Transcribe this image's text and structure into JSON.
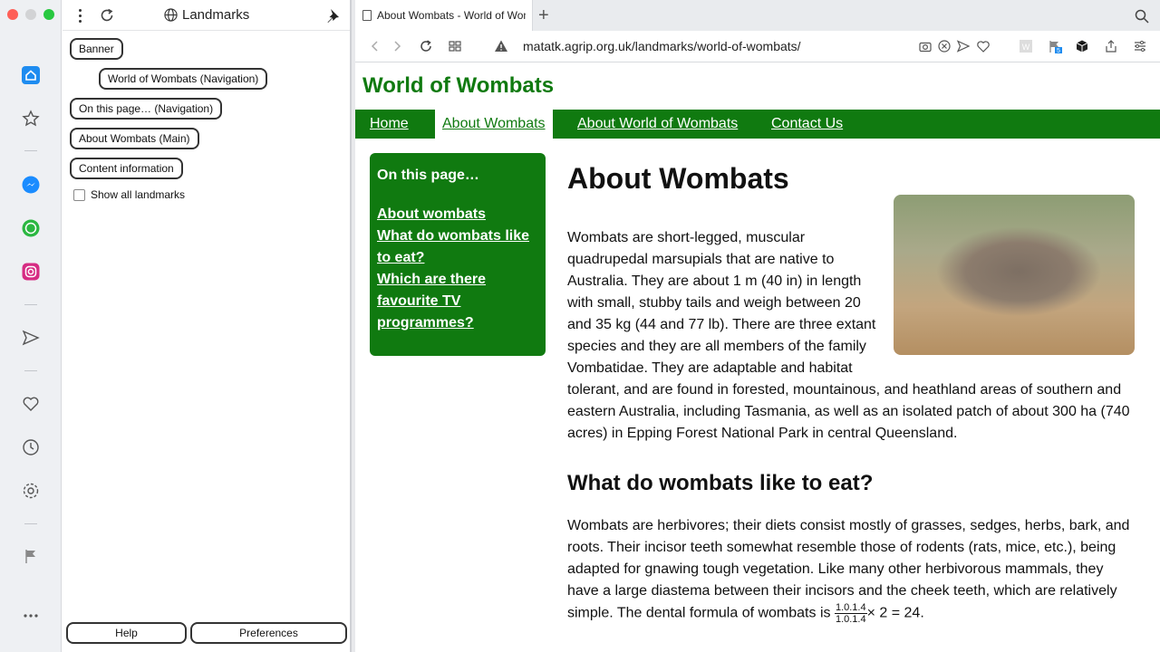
{
  "panel": {
    "title": "Landmarks",
    "landmarks": [
      "Banner",
      "World of Wombats (Navigation)",
      "On this page… (Navigation)",
      "About Wombats (Main)",
      "Content information"
    ],
    "show_all_label": "Show all landmarks",
    "help_label": "Help",
    "preferences_label": "Preferences"
  },
  "browser": {
    "tab_title": "About Wombats - World of Wombats",
    "new_tab": "+",
    "url": "matatk.agrip.org.uk/landmarks/world-of-wombats/"
  },
  "site": {
    "title": "World of Wombats",
    "nav": [
      "Home",
      "About Wombats",
      "About World of Wombats",
      "Contact Us"
    ],
    "toc": {
      "heading": "On this page…",
      "links": [
        "About wombats",
        "What do wombats like to eat?",
        "Which are there favourite TV programmes?"
      ]
    },
    "main": {
      "h1": "About Wombats",
      "p1": "Wombats are short-legged, muscular quadrupedal marsupials that are native to Australia. They are about 1 m (40 in) in length with small, stubby tails and weigh between 20 and 35 kg (44 and 77 lb). There are three extant species and they are all members of the family Vombatidae. They are adaptable and habitat tolerant, and are found in forested, mountainous, and heathland areas of southern and eastern Australia, including Tasmania, as well as an isolated patch of about 300 ha (740 acres) in Epping Forest National Park in central Queensland.",
      "h2": "What do wombats like to eat?",
      "p2": "Wombats are herbivores; their diets consist mostly of grasses, sedges, herbs, bark, and roots. Their incisor teeth somewhat resemble those of rodents (rats, mice, etc.), being adapted for gnawing tough vegetation. Like many other herbivorous mammals, they have a large diastema between their incisors and the cheek teeth, which are relatively simple. The dental formula of wombats is",
      "formula_num": "1.0.1.4",
      "formula_den": "1.0.1.4",
      "formula_tail": "× 2 = 24."
    }
  },
  "colors": {
    "site_green": "#107a10",
    "tab_bg": "#e9ebee"
  }
}
